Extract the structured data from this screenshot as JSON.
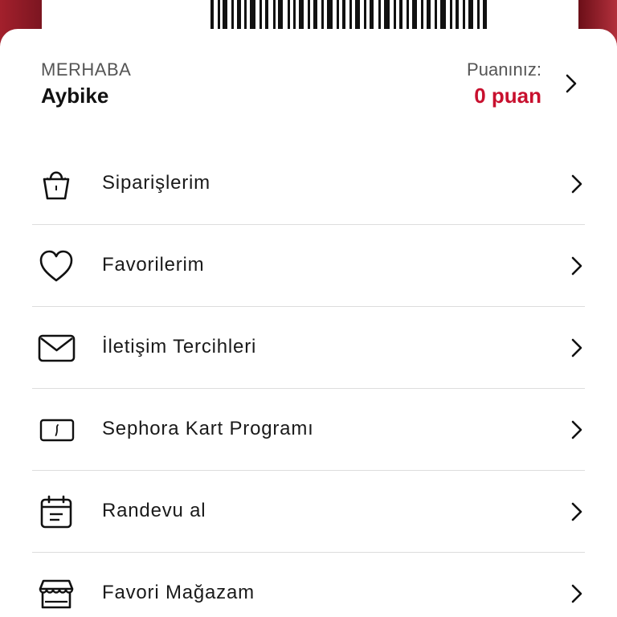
{
  "header": {
    "greeting": "MERHABA",
    "name": "Aybike",
    "points_label": "Puanınız:",
    "points_value": "0 puan"
  },
  "menu": {
    "items": [
      {
        "label": "Siparişlerim",
        "icon": "shopping-bag-icon"
      },
      {
        "label": "Favorilerim",
        "icon": "heart-icon"
      },
      {
        "label": "İletişim Tercihleri",
        "icon": "envelope-icon"
      },
      {
        "label": "Sephora Kart Programı",
        "icon": "card-icon"
      },
      {
        "label": "Randevu al",
        "icon": "calendar-icon"
      },
      {
        "label": "Favori Mağazam",
        "icon": "store-icon"
      }
    ]
  },
  "colors": {
    "accent": "#c8102e",
    "background_top": "#5e0f16",
    "divider": "#dddddd",
    "text": "#1a1a1a"
  }
}
